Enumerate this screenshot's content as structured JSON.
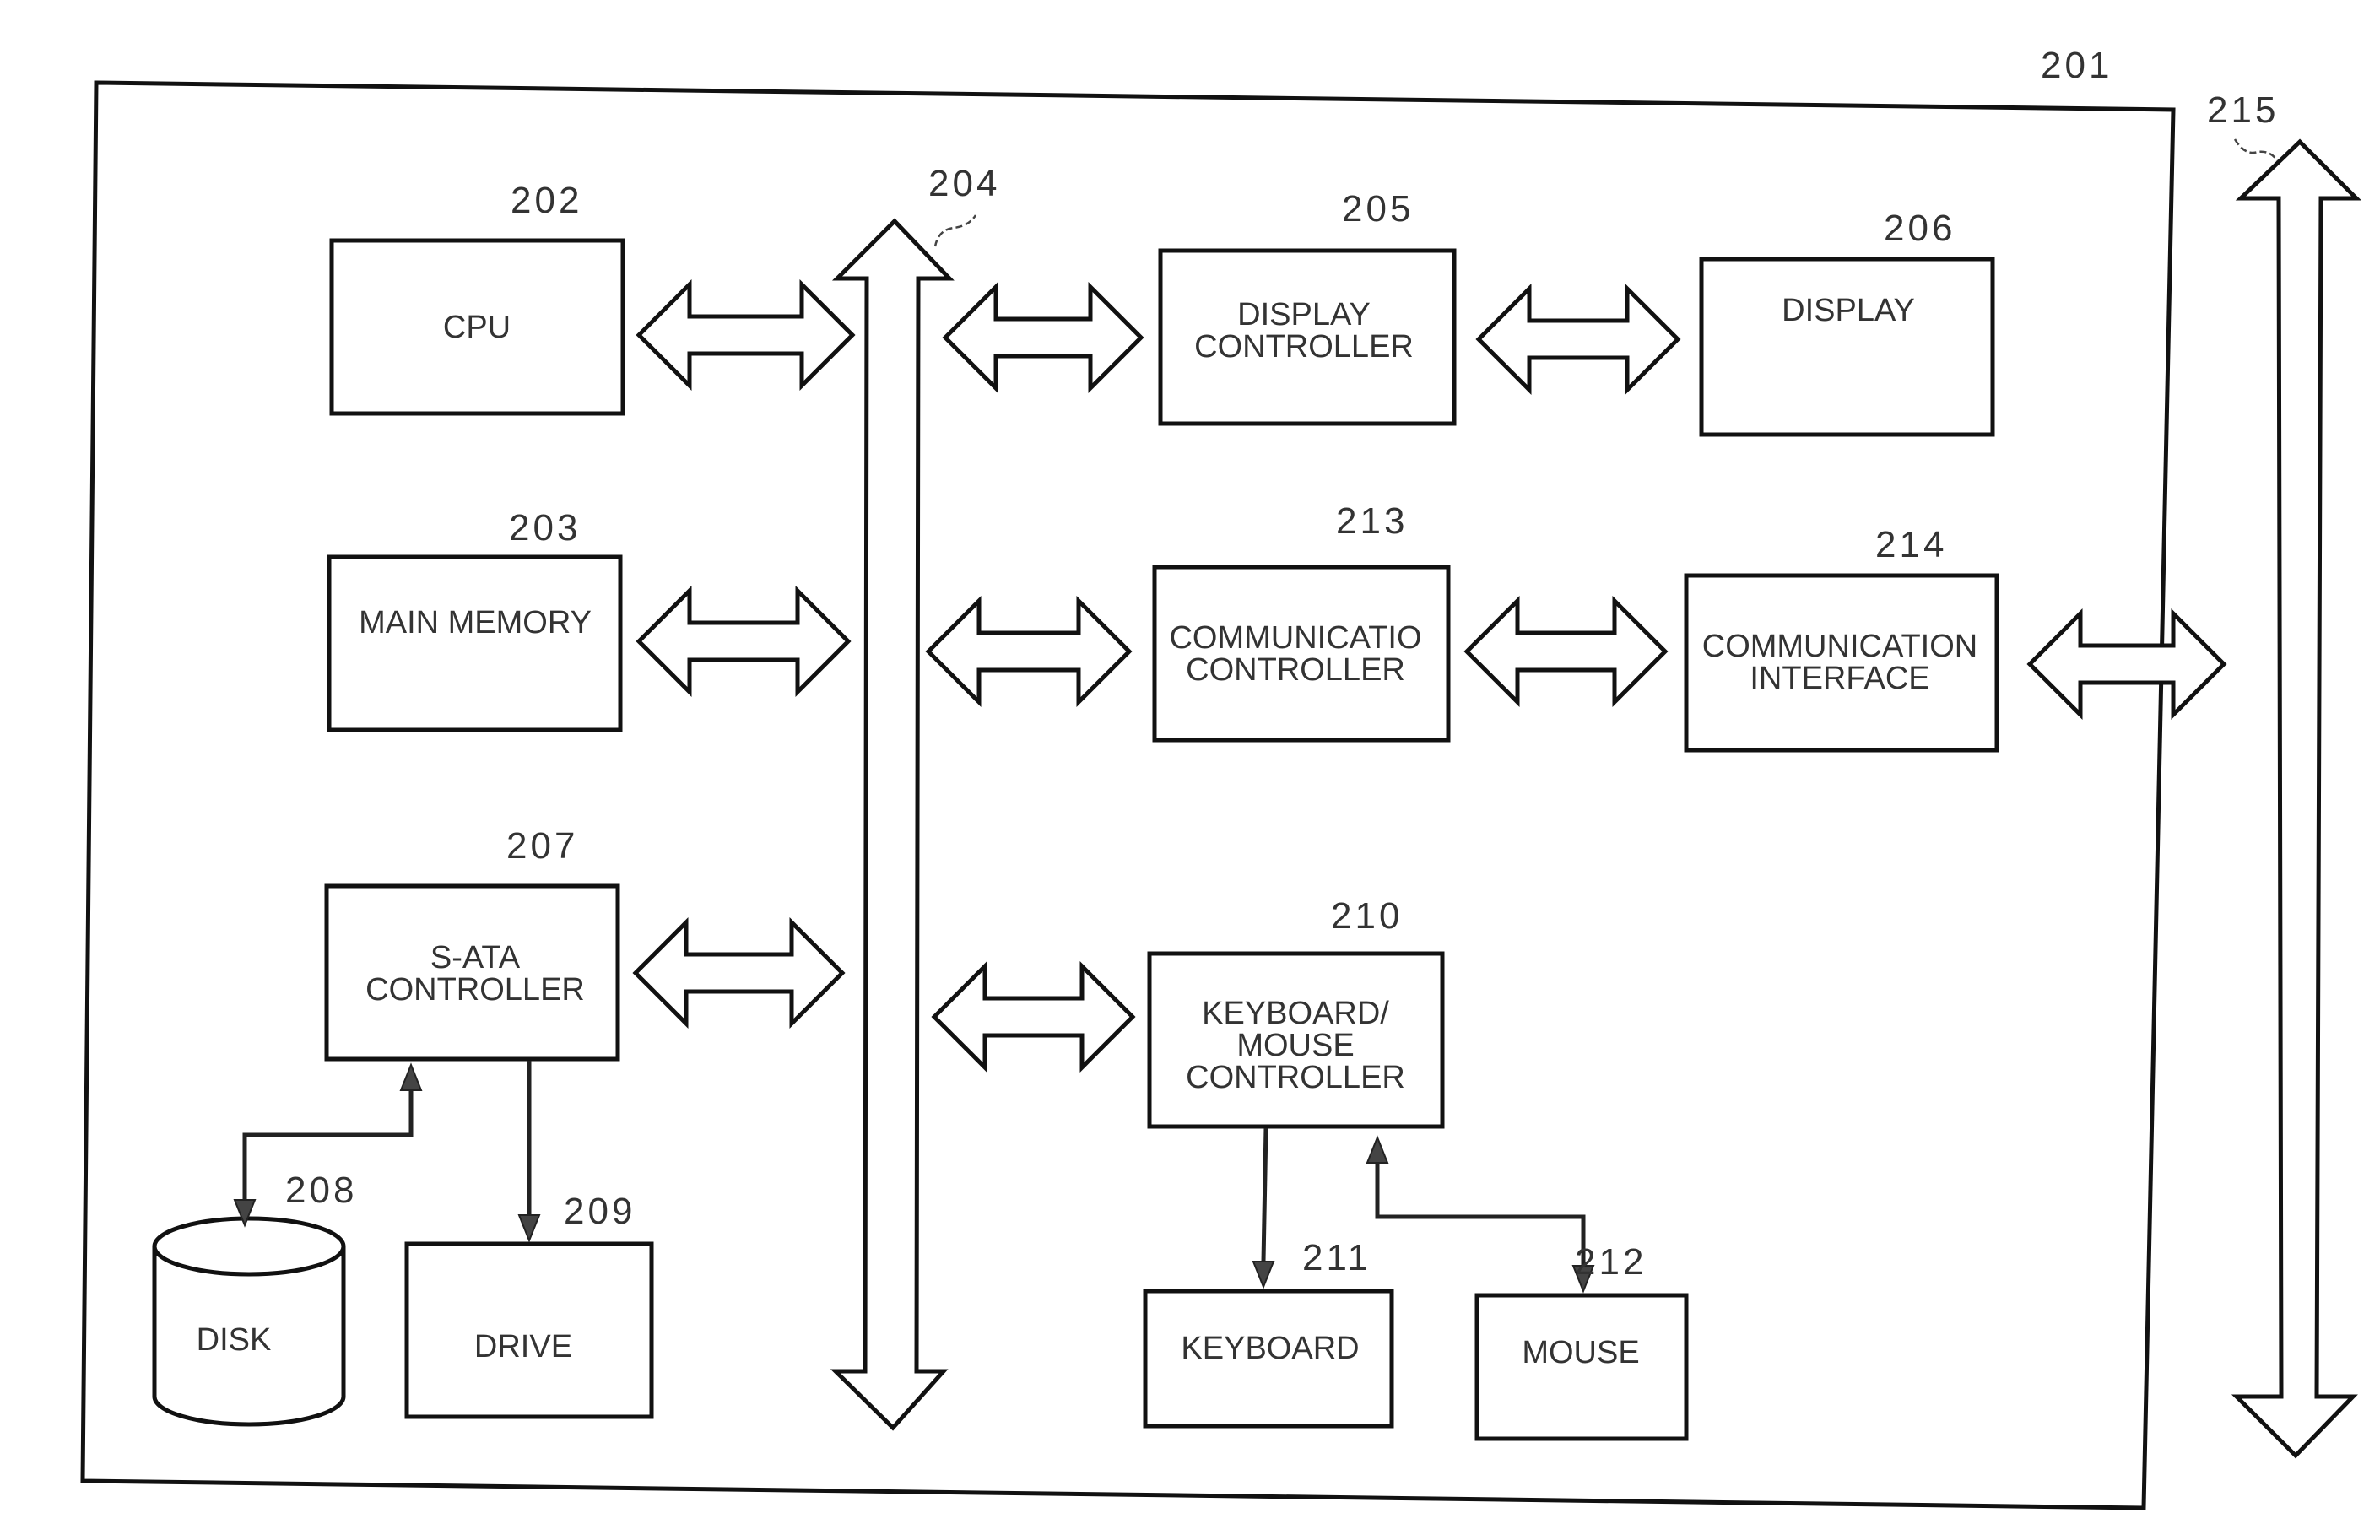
{
  "refs": {
    "system": "201",
    "cpu": "202",
    "main_memory": "203",
    "system_bus": "204",
    "display_controller": "205",
    "display": "206",
    "sata_controller": "207",
    "disk": "208",
    "drive": "209",
    "kbd_mouse_controller": "210",
    "keyboard": "211",
    "mouse": "212",
    "comm_controller": "213",
    "comm_interface": "214",
    "network": "215"
  },
  "labels": {
    "cpu": [
      "CPU"
    ],
    "main_memory": [
      "MAIN MEMORY"
    ],
    "display_controller": [
      "DISPLAY",
      "CONTROLLER"
    ],
    "display": [
      "DISPLAY"
    ],
    "comm_controller": [
      "COMMUNICATIO",
      "CONTROLLER"
    ],
    "comm_interface": [
      "COMMUNICATION",
      "INTERFACE"
    ],
    "sata_controller": [
      "S-ATA",
      "CONTROLLER"
    ],
    "kbd_mouse_controller": [
      "KEYBOARD/",
      "MOUSE",
      "CONTROLLER"
    ],
    "disk": [
      "DISK"
    ],
    "drive": [
      "DRIVE"
    ],
    "keyboard": [
      "KEYBOARD"
    ],
    "mouse": [
      "MOUSE"
    ]
  }
}
